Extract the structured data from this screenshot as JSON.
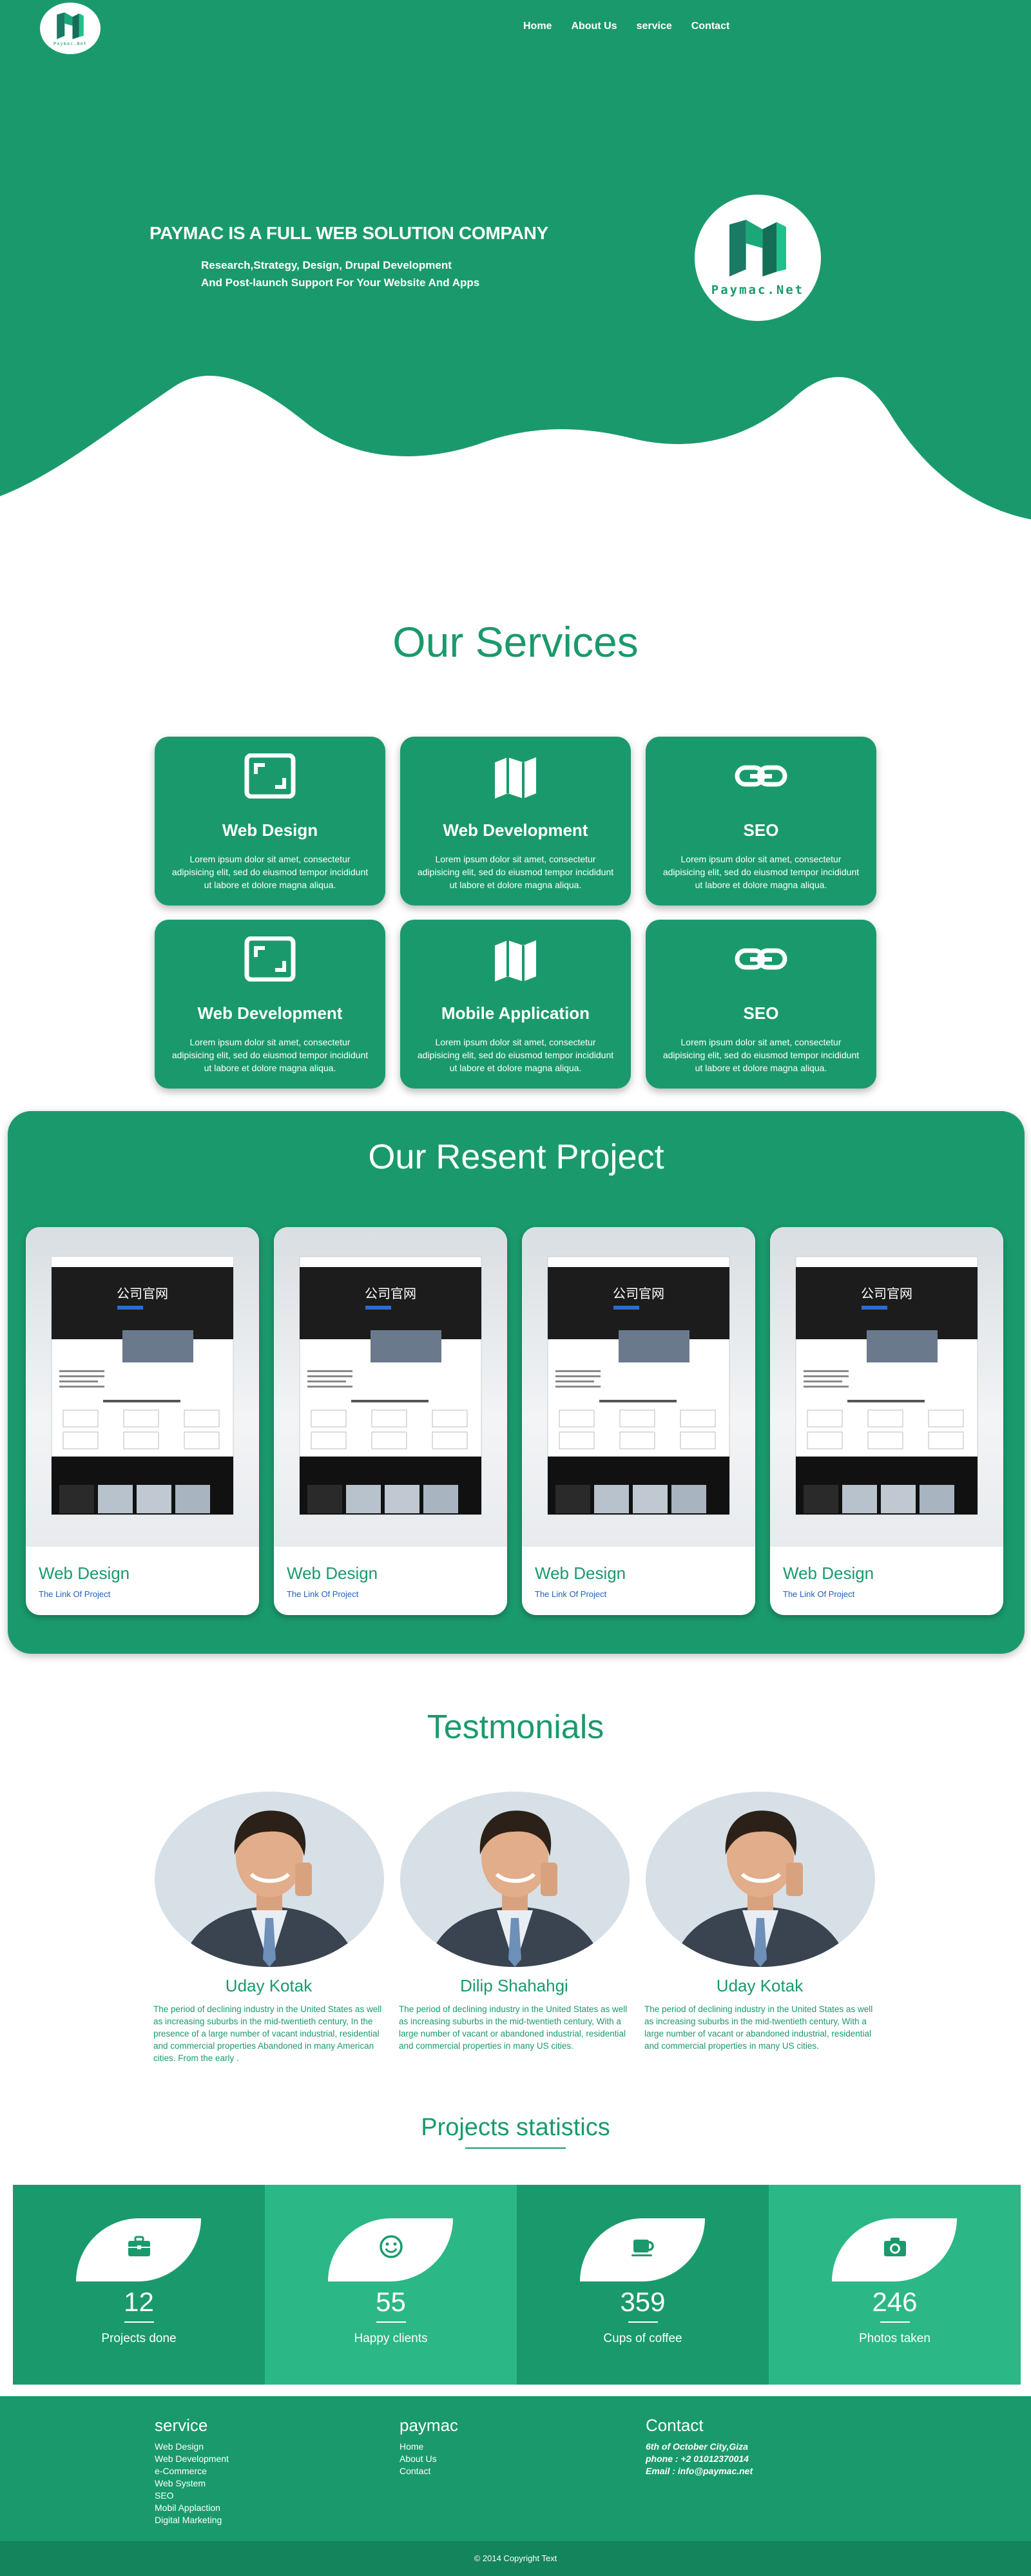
{
  "brand": {
    "logo_text": "Paymac.Net"
  },
  "nav": [
    {
      "label": "Home"
    },
    {
      "label": "About Us"
    },
    {
      "label": "service"
    },
    {
      "label": "Contact"
    }
  ],
  "hero": {
    "title": "PAYMAC IS A FULL WEB SOLUTION COMPANY",
    "subtitle1": "Research,Strategy, Design, Drupal Development",
    "subtitle2": "And Post-launch Support For Your Website And Apps"
  },
  "services": {
    "heading": "Our Services",
    "items": [
      {
        "title": "Web Design",
        "icon": "frame-icon",
        "text": "Lorem ipsum dolor sit amet, consectetur adipisicing elit, sed do eiusmod tempor incididunt ut labore et dolore magna aliqua."
      },
      {
        "title": "Web Development",
        "icon": "map-icon",
        "text": "Lorem ipsum dolor sit amet, consectetur adipisicing elit, sed do eiusmod tempor incididunt ut labore et dolore magna aliqua."
      },
      {
        "title": "SEO",
        "icon": "link-icon",
        "text": "Lorem ipsum dolor sit amet, consectetur adipisicing elit, sed do eiusmod tempor incididunt ut labore et dolore magna aliqua."
      },
      {
        "title": "Web Development",
        "icon": "frame-icon",
        "text": "Lorem ipsum dolor sit amet, consectetur adipisicing elit, sed do eiusmod tempor incididunt ut labore et dolore magna aliqua."
      },
      {
        "title": "Mobile Application",
        "icon": "map-icon",
        "text": "Lorem ipsum dolor sit amet, consectetur adipisicing elit, sed do eiusmod tempor incididunt ut labore et dolore magna aliqua."
      },
      {
        "title": "SEO",
        "icon": "link-icon",
        "text": "Lorem ipsum dolor sit amet, consectetur adipisicing elit, sed do eiusmod tempor incididunt ut labore et dolore magna aliqua."
      }
    ]
  },
  "projects": {
    "heading": "Our Resent Project",
    "screenshot_title": "公司官网",
    "items": [
      {
        "title": "Web Design",
        "link": "The Link Of Project"
      },
      {
        "title": "Web Design",
        "link": "The Link Of Project"
      },
      {
        "title": "Web Design",
        "link": "The Link Of Project"
      },
      {
        "title": "Web Design",
        "link": "The Link Of Project"
      }
    ]
  },
  "testimonials": {
    "heading": "Testmonials",
    "items": [
      {
        "name": "Uday Kotak",
        "quote": "The period of declining industry in the United States as well as increasing suburbs in the mid-twentieth century, In the presence of a large number of vacant industrial, residential and commercial properties Abandoned in many American cities. From the early ."
      },
      {
        "name": "Dilip Shahahgi",
        "quote": "The period of declining industry in the United States as well as increasing suburbs in the mid-twentieth century, With a large number of vacant or abandoned industrial, residential and commercial properties in many US cities."
      },
      {
        "name": "Uday Kotak",
        "quote": "The period of declining industry in the United States as well as increasing suburbs in the mid-twentieth century, With a large number of vacant or abandoned industrial, residential and commercial properties in many US cities."
      }
    ]
  },
  "stats": {
    "heading": "Projects statistics",
    "items": [
      {
        "value": "12",
        "label": "Projects done",
        "icon": "briefcase-icon"
      },
      {
        "value": "55",
        "label": "Happy clients",
        "icon": "smile-icon"
      },
      {
        "value": "359",
        "label": "Cups of coffee",
        "icon": "coffee-icon"
      },
      {
        "value": "246",
        "label": "Photos taken",
        "icon": "camera-icon"
      }
    ]
  },
  "footer": {
    "service": {
      "heading": "service",
      "links": [
        "Web Design",
        "Web Development",
        "e-Commerce",
        "Web System",
        "SEO",
        "Mobil Applaction",
        "Digital Marketing"
      ]
    },
    "paymac": {
      "heading": "paymac",
      "links": [
        "Home",
        "About Us",
        "Contact"
      ]
    },
    "contact": {
      "heading": "Contact",
      "address": "6th of October City,Giza",
      "phone": "phone : +2 01012370014",
      "email": "Email : info@paymac.net"
    },
    "copyright": "© 2014 Copyright Text"
  },
  "colors": {
    "primary": "#1a9a6c",
    "primary_light": "#2bb886",
    "footer_dark": "#14845c",
    "link": "#1f5fbf"
  }
}
